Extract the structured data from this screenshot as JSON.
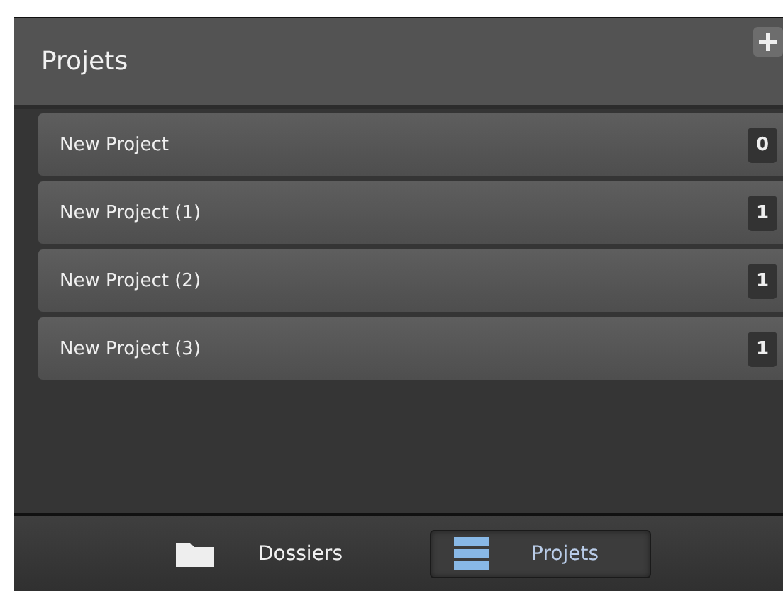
{
  "panel": {
    "title": "Projets"
  },
  "projects": [
    {
      "name": "New Project",
      "count": "0"
    },
    {
      "name": "New Project (1)",
      "count": "1"
    },
    {
      "name": "New Project (2)",
      "count": "1"
    },
    {
      "name": "New Project (3)",
      "count": "1"
    }
  ],
  "tabs": [
    {
      "label": "Dossiers",
      "kind": "folder",
      "selected": false
    },
    {
      "label": "Projets",
      "kind": "list",
      "selected": true
    }
  ]
}
